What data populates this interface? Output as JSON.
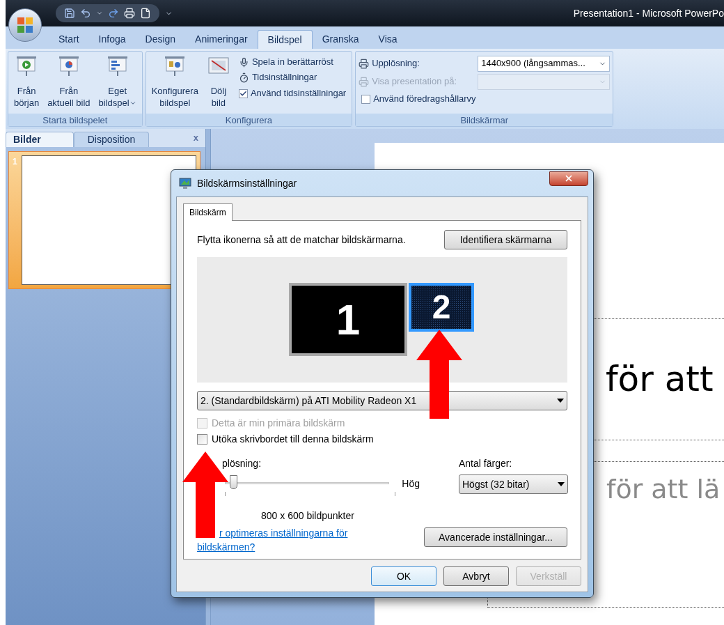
{
  "title_bar": {
    "title": "Presentation1 - Microsoft PowerPo"
  },
  "ribbon_tabs": [
    {
      "label": "Start",
      "selected": false
    },
    {
      "label": "Infoga",
      "selected": false
    },
    {
      "label": "Design",
      "selected": false
    },
    {
      "label": "Animeringar",
      "selected": false
    },
    {
      "label": "Bildspel",
      "selected": true
    },
    {
      "label": "Granska",
      "selected": false
    },
    {
      "label": "Visa",
      "selected": false
    }
  ],
  "ribbon_groups": [
    {
      "title": "Starta bildspelet",
      "items": [
        {
          "kind": "large",
          "lines": [
            "Från",
            "början"
          ]
        },
        {
          "kind": "large",
          "lines": [
            "Från",
            "aktuell bild"
          ]
        },
        {
          "kind": "large",
          "lines": [
            "Eget",
            "bildspel"
          ],
          "menu": true
        }
      ]
    },
    {
      "title": "Konfigurera",
      "items": [
        {
          "kind": "large",
          "lines": [
            "Konfigurera",
            "bildspel"
          ]
        },
        {
          "kind": "large",
          "lines": [
            "Dölj",
            "bild"
          ]
        },
        {
          "kind": "column",
          "entries": [
            {
              "kind": "small",
              "label": "Spela in berättarröst"
            },
            {
              "kind": "small",
              "label": "Tidsinställningar"
            },
            {
              "kind": "check",
              "label": "Använd tidsinställningar",
              "checked": true
            }
          ]
        }
      ]
    },
    {
      "title": "Bildskärmar",
      "items": [
        {
          "kind": "column",
          "entries": [
            {
              "kind": "field",
              "label": "Upplösning:",
              "value": "1440x900 (långsammas...",
              "disabled": false
            },
            {
              "kind": "field",
              "label": "Visa presentation på:",
              "disabled": true
            },
            {
              "kind": "check",
              "label": "Använd föredragshållarvy",
              "checked": false
            }
          ]
        }
      ]
    }
  ],
  "pane": {
    "tabs": [
      {
        "label": "Bilder",
        "selected": true
      },
      {
        "label": "Disposition",
        "selected": false
      }
    ],
    "close": "x",
    "slides": [
      {
        "number": "1",
        "selected": true
      }
    ]
  },
  "slide": {
    "title": "för att",
    "subtitle": "för att lä"
  },
  "dialog": {
    "title": "Bildskärmsinställningar",
    "tabs": [
      {
        "label": "Bildskärm",
        "selected": true
      }
    ],
    "instruction": "Flytta ikonerna så att de matchar bildskärmarna.",
    "identify_button": "Identifiera skärmarna",
    "monitors": [
      {
        "label": "1",
        "selected": false
      },
      {
        "label": "2",
        "selected": true
      }
    ],
    "monitor_select": "2. (Standardbildskärm) på ATI Mobility Radeon X1",
    "checks": [
      {
        "label": "Detta är min primära bildskärm",
        "checked": false,
        "disabled": true
      },
      {
        "label": "Utöka skrivbordet till denna bildskärm",
        "checked": false,
        "disabled": false
      }
    ],
    "resolution": {
      "label": "plösning:",
      "high_label": "Hög",
      "level": 0.03,
      "reading": "800 x 600 bildpunkter"
    },
    "colors": {
      "label": "Antal färger:",
      "value": "Högst (32 bitar)"
    },
    "help_link": "r optimeras inställningarna för bildskärmen?",
    "advanced_button": "Avancerade inställningar...",
    "buttons": [
      {
        "label": "OK",
        "default": true,
        "disabled": false
      },
      {
        "label": "Avbryt",
        "default": false,
        "disabled": false
      },
      {
        "label": "Verkställ",
        "default": false,
        "disabled": true
      }
    ]
  }
}
